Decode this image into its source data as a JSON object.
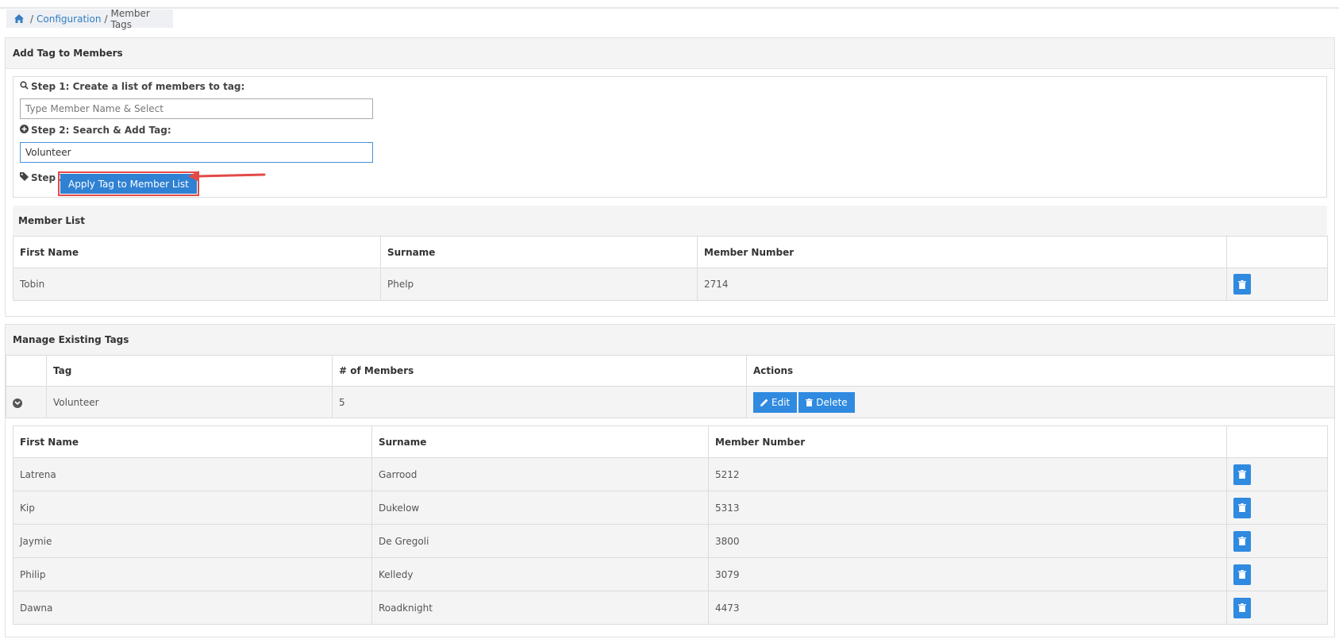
{
  "breadcrumb": {
    "link": "Configuration",
    "separator": "/",
    "current": "Member Tags"
  },
  "add_panel": {
    "title": "Add Tag to Members",
    "step1_label": "Step 1: Create a list of members to tag:",
    "step1_placeholder": "Type Member Name & Select",
    "step2_label": "Step 2: Search & Add Tag:",
    "step2_value": "Volunteer",
    "step3_label": "Step 3:",
    "apply_button": "Apply Tag to Member List"
  },
  "member_list": {
    "title": "Member List",
    "headers": [
      "First Name",
      "Surname",
      "Member Number"
    ],
    "rows": [
      {
        "first": "Tobin",
        "surname": "Phelp",
        "number": "2714"
      }
    ]
  },
  "manage_panel": {
    "title": "Manage Existing Tags",
    "headers": [
      "Tag",
      "# of Members",
      "Actions"
    ],
    "tag_row": {
      "tag": "Volunteer",
      "count": "5",
      "edit_label": "Edit",
      "delete_label": "Delete"
    },
    "member_headers": [
      "First Name",
      "Surname",
      "Member Number"
    ],
    "members": [
      {
        "first": "Latrena",
        "surname": "Garrood",
        "number": "5212"
      },
      {
        "first": "Kip",
        "surname": "Dukelow",
        "number": "5313"
      },
      {
        "first": "Jaymie",
        "surname": "De Gregoli",
        "number": "3800"
      },
      {
        "first": "Philip",
        "surname": "Kelledy",
        "number": "3079"
      },
      {
        "first": "Dawna",
        "surname": "Roadknight",
        "number": "4473"
      }
    ]
  },
  "colors": {
    "primary": "#2f81d3",
    "highlight": "#e24a48",
    "link": "#2f7ec4"
  },
  "icons": [
    "home-icon",
    "search-icon",
    "plus-circle-icon",
    "tag-icon",
    "trash-icon",
    "pencil-icon",
    "chevron-down-circle-icon",
    "arrow-annotation"
  ]
}
